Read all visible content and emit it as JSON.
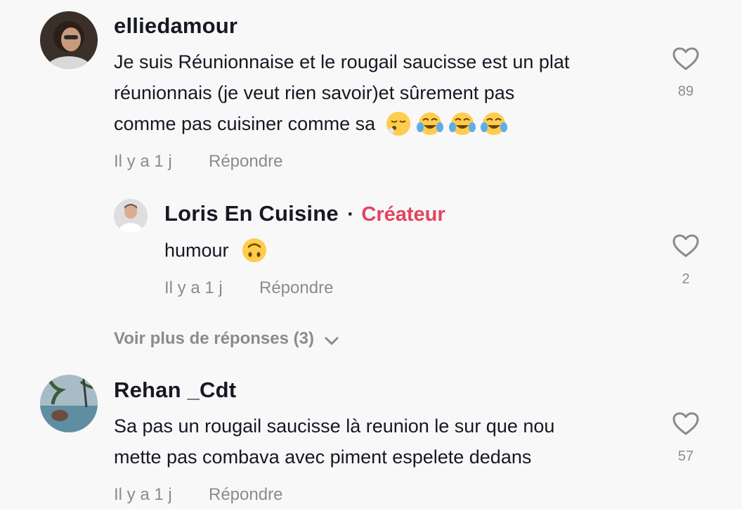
{
  "comments": [
    {
      "username": "elliedamour",
      "text_line1": "Je suis Réunionnaise et le rougail saucisse est un plat",
      "text_line2": "réunionnais (je veut rien savoir)et sûrement pas",
      "text_line3": "comme pas cuisiner comme sa",
      "emoji": [
        "face-exhaling-emoji",
        "tears-of-joy-emoji",
        "tears-of-joy-emoji",
        "tears-of-joy-emoji"
      ],
      "time": "Il y a 1 j",
      "reply_label": "Répondre",
      "likes": "89",
      "avatar_color": "#5a4a40"
    },
    {
      "username": "Rehan _Cdt",
      "text_line1": "Sa pas un rougail saucisse là reunion le sur que nou",
      "text_line2": "mette pas combava avec piment espelete dedans",
      "time": "Il y a 1 j",
      "reply_label": "Répondre",
      "likes": "57",
      "avatar_color": "#4f7a8a"
    }
  ],
  "reply": {
    "username": "Loris En Cuisine",
    "separator": "·",
    "badge": "Créateur",
    "text": "humour",
    "emoji": "upside-down-face-emoji",
    "time": "Il y a 1 j",
    "reply_label": "Répondre",
    "likes": "2",
    "badge_color": "#e2445c"
  },
  "view_more": {
    "label": "Voir plus de réponses (3)"
  }
}
